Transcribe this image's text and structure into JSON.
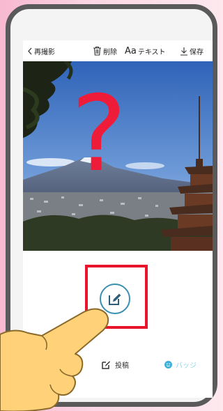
{
  "topbar": {
    "back_label": "再撮影",
    "delete_label": "削除",
    "text_label": "テキスト",
    "text_icon_glyph": "Aa",
    "save_label": "保存"
  },
  "overlay": {
    "question_mark": "?"
  },
  "bottom_bar": {
    "post_label": "投稿",
    "badge_label": "バッジ"
  },
  "icons": {
    "back": "chevron-left-icon",
    "delete": "trash-icon",
    "save": "download-icon",
    "edit": "pencil-icon",
    "post": "pencil-square-icon",
    "badge": "smiley-icon"
  },
  "colors": {
    "question_mark": "#ef1c39",
    "highlight_box": "#e8152b",
    "edit_button_border": "#3a8fb0",
    "badge_label": "#8fd3ea",
    "page_background": "#f7b9d0",
    "phone_frame": "#5a5a5a"
  }
}
